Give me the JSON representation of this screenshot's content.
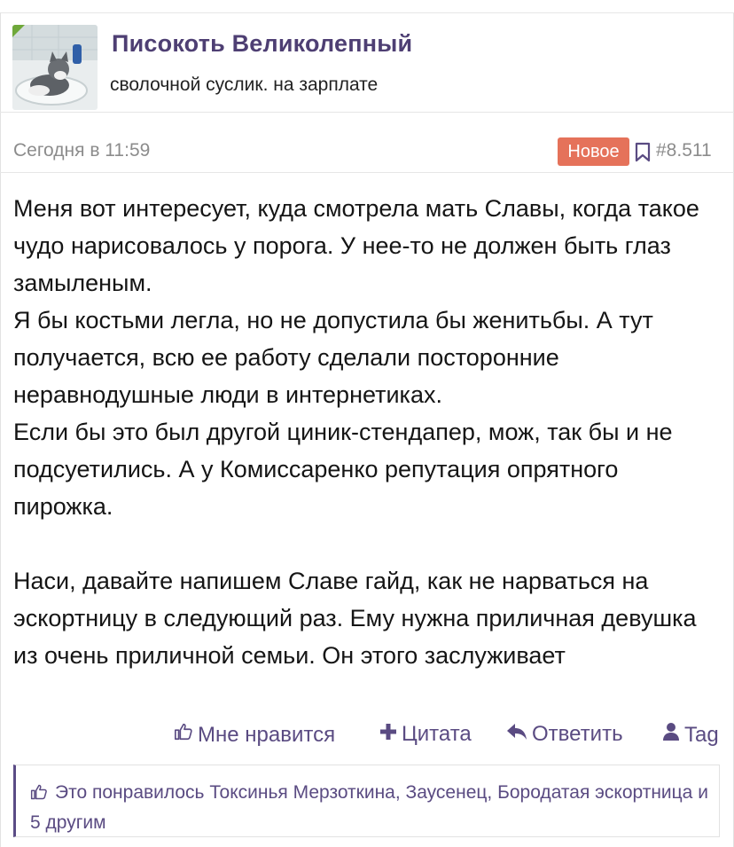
{
  "user": {
    "name": "Писокоть Великолепный",
    "title": "сволочной суслик. на зарплате"
  },
  "post": {
    "date": "Сегодня в 11:59",
    "new_badge": "Новое",
    "number": "#8.511",
    "paragraphs": [
      "Меня вот интересует, куда смотрела мать Славы, когда такое чудо нарисовалось у порога. У нее-то не должен быть глаз замыленым.",
      "Я бы костьми легла, но не допустила бы женитьбы. А тут получается, всю ее работу сделали посторонние неравнодушные люди в интернетиках.",
      "Если бы это был другой циник-стендапер, мож, так бы и не подсуетились. А у Комиссаренко репутация опрятного пирожка.",
      "Наси, давайте напишем Славе гайд, как не нарваться на эскортницу в следующий раз. Ему нужна приличная девушка из очень приличной семьи. Он этого заслуживает"
    ]
  },
  "actions": {
    "like": "Мне нравится",
    "quote": "Цитата",
    "reply": "Ответить",
    "tag": "Tag"
  },
  "likes_summary": "Это понравилось Токсинья Мерзоткина, Заусенец, Бородатая эскортница и 5 другим",
  "colors": {
    "accent": "#5a4b82",
    "username": "#4e3f73",
    "new_badge": "#e5725a",
    "muted": "#8c8c8c"
  },
  "icons": [
    "thumbs-up-icon",
    "plus-icon",
    "reply-icon",
    "user-icon",
    "bookmark-icon"
  ]
}
